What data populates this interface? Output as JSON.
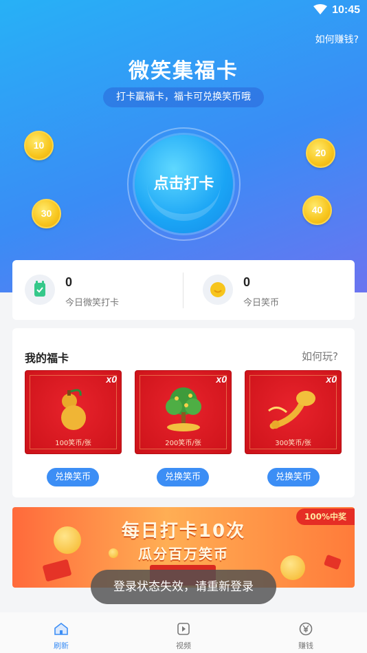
{
  "status_bar": {
    "time": "10:45"
  },
  "header": {
    "how_to_earn": "如何赚钱?",
    "title": "微笑集福卡",
    "subtitle": "打卡赢福卡，福卡可兑换笑币哦",
    "checkin_button": "点击打卡"
  },
  "coins": [
    "10",
    "20",
    "30",
    "40"
  ],
  "stats": [
    {
      "icon": "calendar-check-icon",
      "value": "0",
      "label": "今日微笑打卡"
    },
    {
      "icon": "smile-coin-icon",
      "value": "0",
      "label": "今日笑币"
    }
  ],
  "fuka": {
    "heading": "我的福卡",
    "how_to_play": "如何玩?",
    "cards": [
      {
        "count": "x0",
        "price": "100笑币/张",
        "button": "兑换笑币",
        "art": "gourd"
      },
      {
        "count": "x0",
        "price": "200笑币/张",
        "button": "兑换笑币",
        "art": "money-tree"
      },
      {
        "count": "x0",
        "price": "300笑币/张",
        "button": "兑换笑币",
        "art": "ruyi"
      }
    ]
  },
  "banner": {
    "line1": "每日打卡10次",
    "line2": "瓜分百万笑币",
    "badge": "100%中奖"
  },
  "toast": "登录状态失效，请重新登录",
  "tabs": [
    {
      "label": "刷新",
      "icon": "home-icon",
      "active": true
    },
    {
      "label": "视频",
      "icon": "video-icon",
      "active": false
    },
    {
      "label": "赚钱",
      "icon": "yen-icon",
      "active": false
    }
  ],
  "colors": {
    "accent": "#3c8ef5",
    "hero_start": "#27b1f6",
    "hero_end": "#6b74f0",
    "card_red": "#e8232c"
  }
}
